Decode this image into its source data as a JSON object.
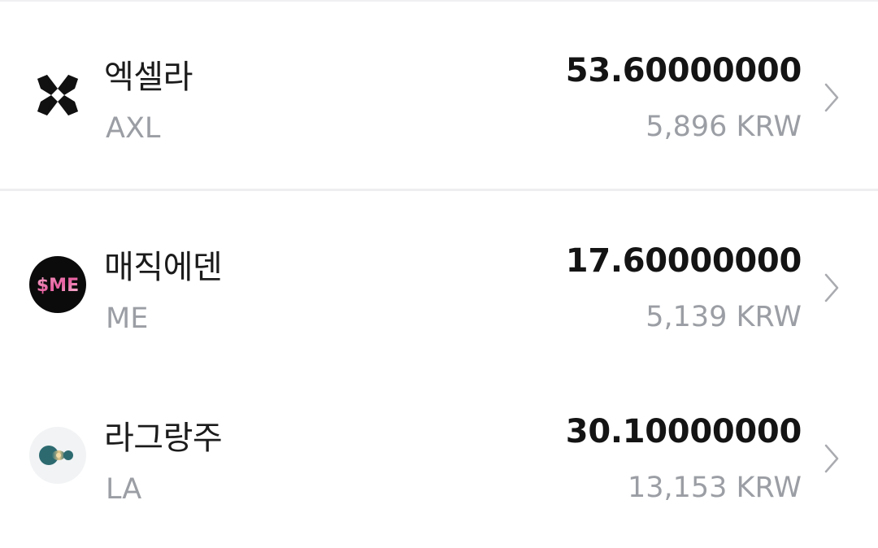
{
  "assets": [
    {
      "name": "엑셀라",
      "symbol": "AXL",
      "amount": "53.60000000",
      "krw_value": "5,896 KRW",
      "icon": "axelar-logo-icon"
    },
    {
      "name": "매직에덴",
      "symbol": "ME",
      "amount": "17.60000000",
      "krw_value": "5,139 KRW",
      "icon": "magic-eden-logo-icon",
      "icon_text": "$ME"
    },
    {
      "name": "라그랑주",
      "symbol": "LA",
      "amount": "30.10000000",
      "krw_value": "13,153 KRW",
      "icon": "lagrange-logo-icon"
    }
  ],
  "colors": {
    "primary_text": "#141414",
    "secondary_text": "#9b9ea4",
    "chevron": "#a9abb0",
    "divider": "#eeeef0"
  },
  "chevron_icon": "chevron-right-icon"
}
